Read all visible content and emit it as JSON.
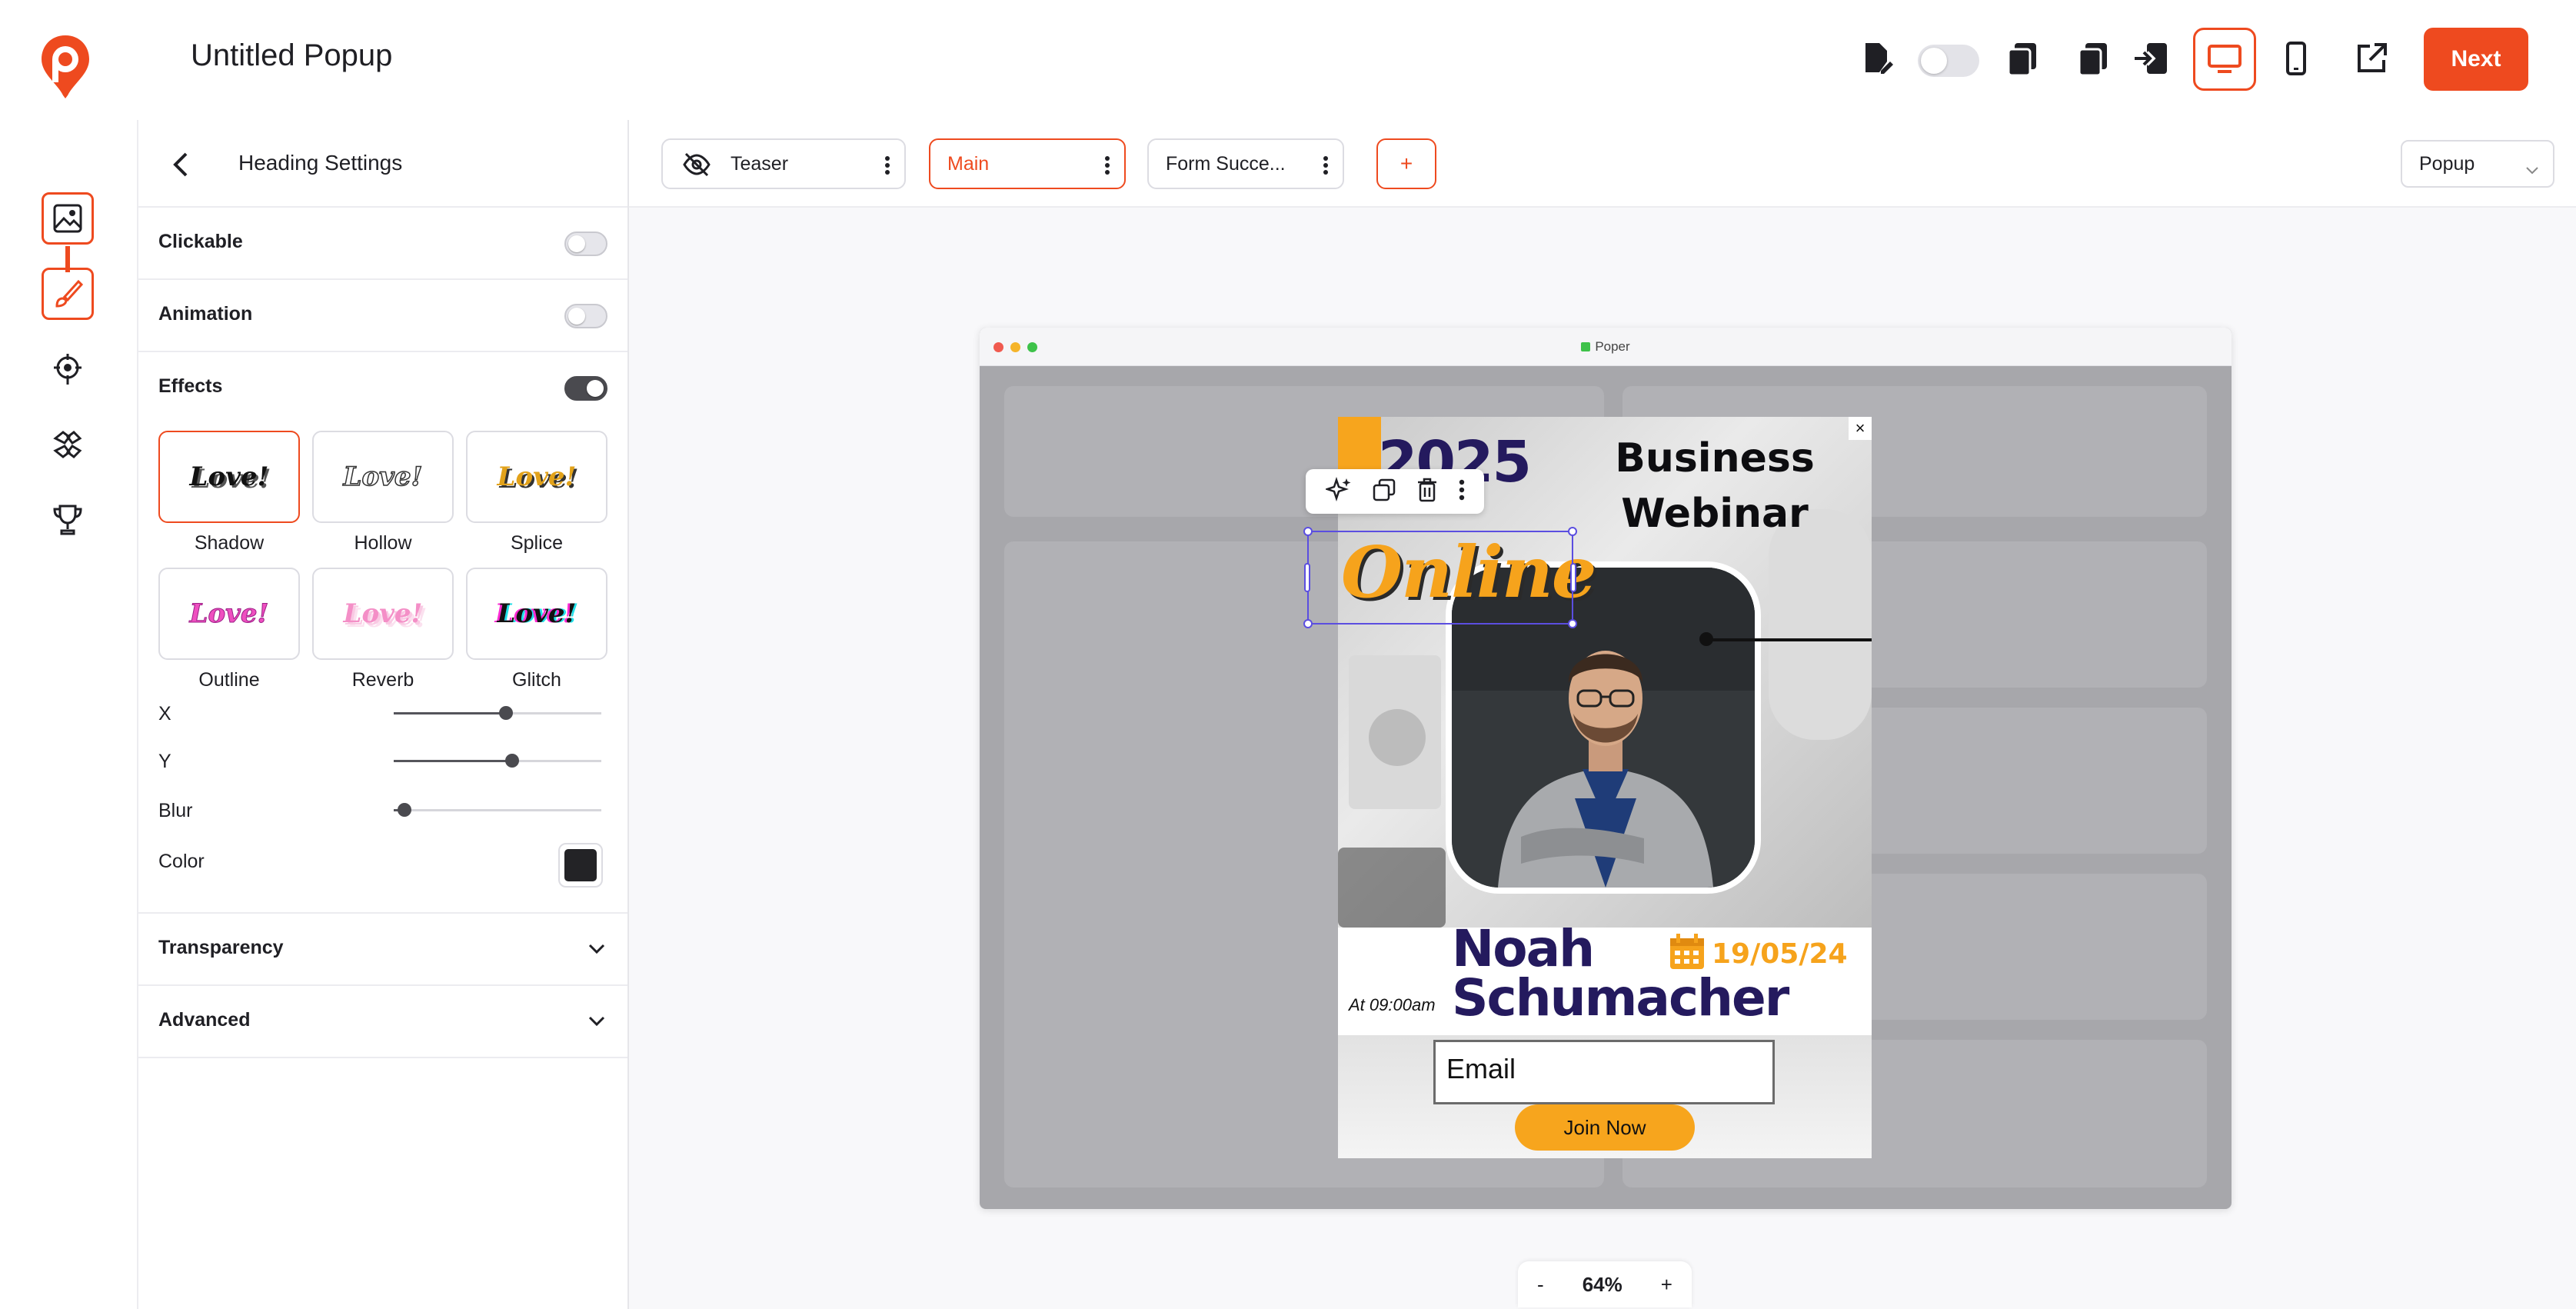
{
  "header": {
    "title": "Untitled Popup",
    "next_label": "Next"
  },
  "panel": {
    "title": "Heading Settings",
    "rows": {
      "clickable": "Clickable",
      "animation": "Animation",
      "effects": "Effects",
      "transparency": "Transparency",
      "advanced": "Advanced"
    },
    "effects": [
      {
        "preview": "Love!",
        "label": "Shadow"
      },
      {
        "preview": "Love!",
        "label": "Hollow"
      },
      {
        "preview": "Love!",
        "label": "Splice"
      },
      {
        "preview": "Love!",
        "label": "Outline"
      },
      {
        "preview": "Love!",
        "label": "Reverb"
      },
      {
        "preview": "Love!",
        "label": "Glitch"
      }
    ],
    "sliders": {
      "x_label": "X",
      "y_label": "Y",
      "blur_label": "Blur",
      "x_value": 0.54,
      "y_value": 0.57,
      "blur_value": 0.05
    },
    "color_label": "Color",
    "effect_color": "#232326"
  },
  "tabs": {
    "items": [
      {
        "label": "Teaser"
      },
      {
        "label": "Main"
      },
      {
        "label": "Form Succe..."
      }
    ],
    "add_label": "+",
    "view_select": "Popup"
  },
  "browser": {
    "url": "Poper"
  },
  "popup": {
    "year": "2025",
    "title_line1": "Business",
    "title_line2": "Webinar",
    "tagline": "Online",
    "close": "×",
    "time": "At 09:00am",
    "name_line1": "Noah",
    "name_line2": "Schumacher",
    "date": "19/05/24",
    "email_placeholder": "Email",
    "cta": "Join Now"
  },
  "zoom": {
    "minus": "-",
    "level": "64%",
    "plus": "+"
  },
  "colors": {
    "accent": "#ee4a1f",
    "poster_orange": "#f6a31c",
    "poster_navy": "#241a5e"
  }
}
